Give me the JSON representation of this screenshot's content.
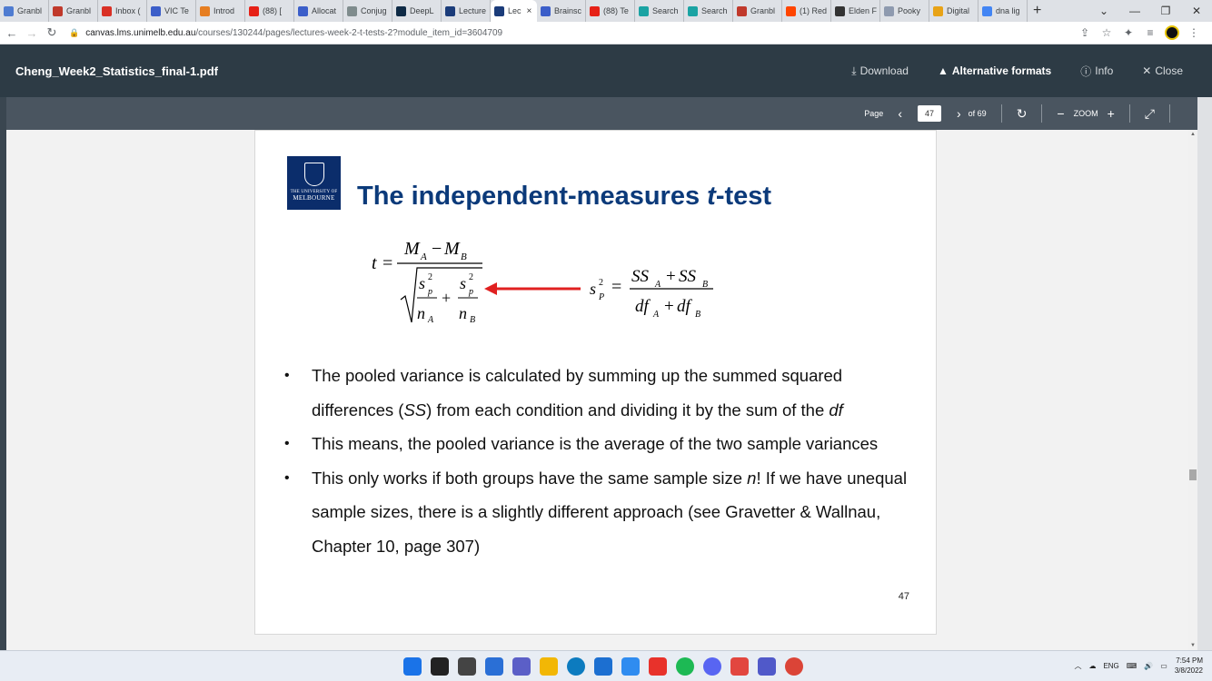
{
  "browser": {
    "tabs": [
      {
        "label": "Granbl",
        "color": "#4f7cd1"
      },
      {
        "label": "Granbl",
        "color": "#c0392b"
      },
      {
        "label": "Inbox (",
        "color": "#d93025"
      },
      {
        "label": "VIC Te",
        "color": "#3b5ec9"
      },
      {
        "label": "Introd",
        "color": "#e67e22"
      },
      {
        "label": "(88) [",
        "color": "#e62117"
      },
      {
        "label": "Allocat",
        "color": "#3b5ec9"
      },
      {
        "label": "Conjug",
        "color": "#7f8c8d"
      },
      {
        "label": "DeepL",
        "color": "#0f2b46"
      },
      {
        "label": "Lecture",
        "color": "#1b3c7a"
      },
      {
        "label": "Lec",
        "color": "#1b3c7a",
        "active": true
      },
      {
        "label": "Brainsc",
        "color": "#3b5ec9"
      },
      {
        "label": "(88) Te",
        "color": "#e62117"
      },
      {
        "label": "Search",
        "color": "#1aa3a3"
      },
      {
        "label": "Search",
        "color": "#1aa3a3"
      },
      {
        "label": "Granbl",
        "color": "#c0392b"
      },
      {
        "label": "(1) Red",
        "color": "#ff4500"
      },
      {
        "label": "Elden F",
        "color": "#333333"
      },
      {
        "label": "Pooky",
        "color": "#8e9aaf"
      },
      {
        "label": "Digital",
        "color": "#e8a317"
      },
      {
        "label": "dna lig",
        "color": "#4285f4"
      }
    ],
    "close_tab_glyph": "×",
    "new_tab_glyph": "+",
    "window_controls": [
      "⌄",
      "—",
      "❐",
      "✕"
    ],
    "url_host": "canvas.lms.unimelb.edu.au",
    "url_path": "/courses/130244/pages/lectures-week-2-t-tests-2?module_item_id=3604709"
  },
  "viewer": {
    "filename": "Cheng_Week2_Statistics_final-1.pdf",
    "actions": {
      "download": "Download",
      "alt_formats": "Alternative formats",
      "info": "Info",
      "close": "Close"
    },
    "toolbar": {
      "page_label": "Page",
      "current_page": "47",
      "total_pages": "of 69",
      "zoom_label": "ZOOM"
    }
  },
  "slide": {
    "logo_line1": "THE UNIVERSITY OF",
    "logo_line2": "MELBOURNE",
    "title_pre": "The independent-measures ",
    "title_t": "t",
    "title_post": "-test",
    "formula": {
      "t": "t",
      "eq": "=",
      "numerator": "M",
      "sub_a": "A",
      "minus": "−",
      "sub_b": "B",
      "sp": "s",
      "p": "p",
      "sq": "2",
      "plus": "+",
      "n": "n",
      "sp_lhs": "s",
      "p_big": "P",
      "ss": "SS",
      "df": "df"
    },
    "bullets": [
      {
        "pre": "The pooled variance is calculated by summing up the summed squared differences (",
        "it": "SS",
        "mid": ") from each condition and dividing it by the sum of the ",
        "it2": "df",
        "post": ""
      },
      {
        "pre": "This means, the pooled variance is the average of the two sample variances",
        "it": "",
        "mid": "",
        "it2": "",
        "post": ""
      },
      {
        "pre": "This only works if both groups have the same sample size ",
        "it": "n",
        "mid": "! If we have unequal sample sizes, there is a slightly different approach (see Gravetter & Wallnau, Chapter 10, page 307)",
        "it2": "",
        "post": ""
      }
    ],
    "page_number": "47"
  },
  "taskbar": {
    "icons": [
      {
        "name": "start",
        "color": "#1a73e8"
      },
      {
        "name": "search",
        "color": "#222222"
      },
      {
        "name": "taskview",
        "color": "#444444"
      },
      {
        "name": "widgets",
        "color": "#2a6fd6"
      },
      {
        "name": "chat",
        "color": "#5b5fc7"
      },
      {
        "name": "explorer",
        "color": "#f2b705"
      },
      {
        "name": "edge",
        "color": "#0c7bbf"
      },
      {
        "name": "store",
        "color": "#1c6fd1"
      },
      {
        "name": "app-a",
        "color": "#2f8cf0"
      },
      {
        "name": "app-b",
        "color": "#e8322b"
      },
      {
        "name": "spotify",
        "color": "#1db954"
      },
      {
        "name": "discord",
        "color": "#5865f2"
      },
      {
        "name": "app-c",
        "color": "#e2463f"
      },
      {
        "name": "teams",
        "color": "#5059c9"
      },
      {
        "name": "chrome",
        "color": "#db4437"
      }
    ],
    "lang": "ENG",
    "time": "7:54 PM",
    "date": "3/8/2022"
  }
}
